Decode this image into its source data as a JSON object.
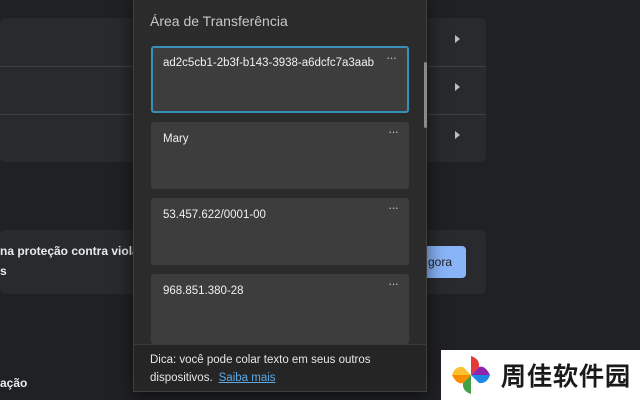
{
  "background": {
    "banner_text": "na proteção contra viola",
    "banner_text_line2": "s",
    "banner_button": "gora",
    "bottom_label": "ação"
  },
  "clipboard": {
    "title": "Área de Transferência",
    "items": [
      {
        "text": "ad2c5cb1-2b3f-b143-3938-a6dcfc7a3aab",
        "more": "···"
      },
      {
        "text": "Mary",
        "more": "···"
      },
      {
        "text": "53.457.622/0001-00",
        "more": "···"
      },
      {
        "text": "968.851.380-28",
        "more": "···"
      }
    ],
    "tip": "Dica: você pode colar texto em seus outros dispositivos.",
    "tip_link": "Saiba mais"
  },
  "watermark": {
    "text": "周佳软件园"
  },
  "colors": {
    "selected_border": "#3a8fb7",
    "link": "#5ea9e6",
    "accent_button": "#8ab4f8"
  }
}
